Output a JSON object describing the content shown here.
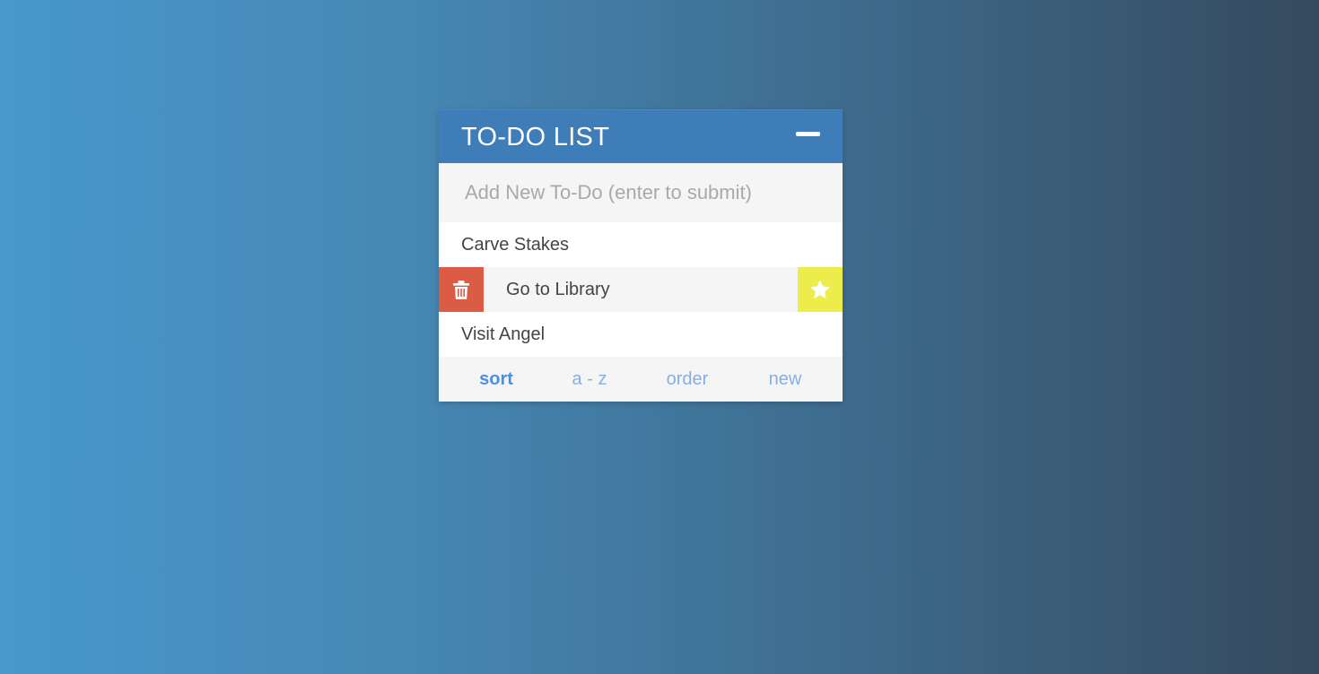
{
  "header": {
    "title": "TO-DO LIST",
    "collapse_icon": "minus-icon"
  },
  "new_todo": {
    "placeholder": "Add New To-Do (enter to submit)",
    "value": ""
  },
  "todos": [
    {
      "label": "Carve Stakes",
      "active": false
    },
    {
      "label": "Go to Library",
      "active": true,
      "actions": [
        "trash-icon",
        "star-icon"
      ]
    },
    {
      "label": "Visit Angel",
      "active": false
    }
  ],
  "footer": {
    "sort_label": "sort",
    "az_label": "a - z",
    "order_label": "order",
    "new_label": "new"
  },
  "colors": {
    "header": "#3f7db8",
    "delete": "#dc5b45",
    "star": "#eced4a",
    "sort_active": "#4a90e2",
    "sort_inactive": "#84b0e6"
  }
}
